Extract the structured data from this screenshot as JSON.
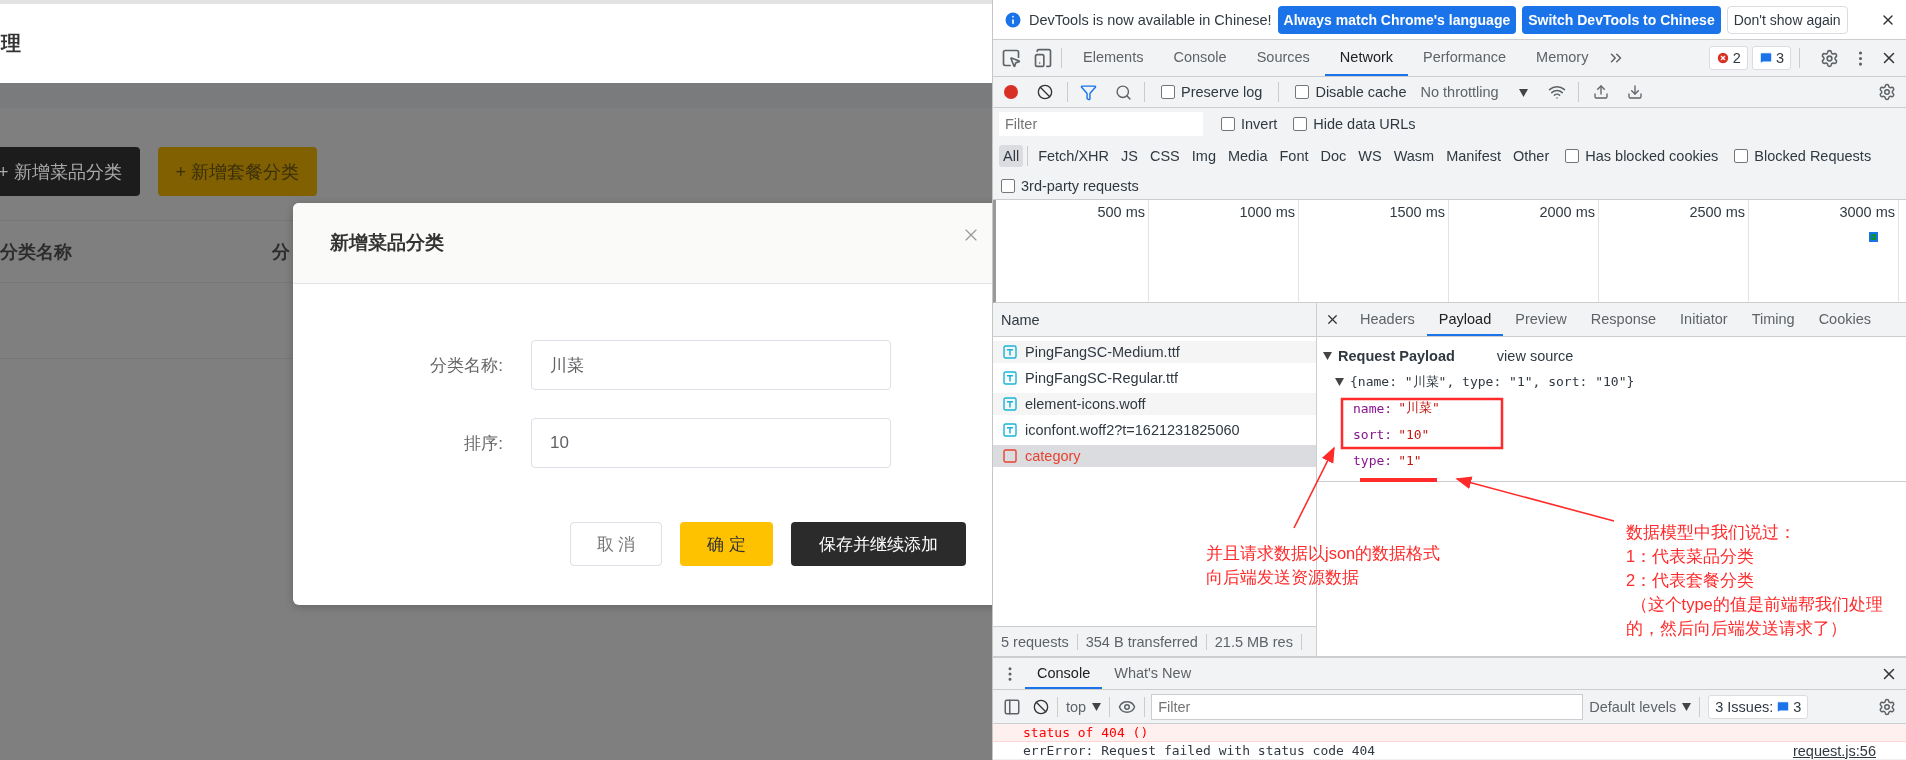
{
  "page": {
    "title": "理",
    "actions": [
      {
        "label": "+ 新增菜品分类",
        "kind": "dark"
      },
      {
        "label": "+ 新增套餐分类",
        "kind": "accent"
      }
    ],
    "columns": [
      "分类名称",
      "分"
    ]
  },
  "dialog": {
    "title": "新增菜品分类",
    "fields": [
      {
        "label": "分类名称:",
        "value": "川菜"
      },
      {
        "label": "排序:",
        "value": "10"
      }
    ],
    "buttons": [
      {
        "label": "取 消",
        "kind": "plain"
      },
      {
        "label": "确 定",
        "kind": "primary"
      },
      {
        "label": "保存并继续添加",
        "kind": "dark"
      }
    ]
  },
  "devtools": {
    "infobar": {
      "message": "DevTools is now available in Chinese!",
      "buttons": [
        {
          "label": "Always match Chrome's language",
          "kind": "primary"
        },
        {
          "label": "Switch DevTools to Chinese",
          "kind": "primary"
        },
        {
          "label": "Don't show again",
          "kind": "plain"
        }
      ]
    },
    "tabs": [
      {
        "label": "Elements",
        "selected": false
      },
      {
        "label": "Console",
        "selected": false
      },
      {
        "label": "Sources",
        "selected": false
      },
      {
        "label": "Network",
        "selected": true
      },
      {
        "label": "Performance",
        "selected": false
      },
      {
        "label": "Memory",
        "selected": false
      }
    ],
    "error_count": "2",
    "message_count": "3",
    "toolbar": {
      "checkboxes": [
        {
          "label": "Preserve log",
          "checked": false
        },
        {
          "label": "Disable cache",
          "checked": false
        }
      ],
      "throttling": "No throttling"
    },
    "filter": {
      "placeholder": "Filter",
      "checkboxes": [
        {
          "label": "Invert",
          "checked": false
        },
        {
          "label": "Hide data URLs",
          "checked": false
        }
      ]
    },
    "types": [
      {
        "label": "All",
        "selected": true
      },
      {
        "label": "Fetch/XHR",
        "selected": false
      },
      {
        "label": "JS",
        "selected": false
      },
      {
        "label": "CSS",
        "selected": false
      },
      {
        "label": "Img",
        "selected": false
      },
      {
        "label": "Media",
        "selected": false
      },
      {
        "label": "Font",
        "selected": false
      },
      {
        "label": "Doc",
        "selected": false
      },
      {
        "label": "WS",
        "selected": false
      },
      {
        "label": "Wasm",
        "selected": false
      },
      {
        "label": "Manifest",
        "selected": false
      },
      {
        "label": "Other",
        "selected": false
      }
    ],
    "type_checkboxes": [
      {
        "label": "Has blocked cookies",
        "checked": false
      },
      {
        "label": "Blocked Requests",
        "checked": false
      },
      {
        "label": "3rd-party requests",
        "checked": false
      }
    ],
    "timeline_ticks": [
      "500 ms",
      "1000 ms",
      "1500 ms",
      "2000 ms",
      "2500 ms",
      "3000 ms"
    ],
    "requests": {
      "header": "Name",
      "rows": [
        {
          "name": "PingFangSC-Medium.ttf",
          "kind": "font",
          "selected": false
        },
        {
          "name": "PingFangSC-Regular.ttf",
          "kind": "font",
          "selected": false
        },
        {
          "name": "element-icons.woff",
          "kind": "font",
          "selected": false
        },
        {
          "name": "iconfont.woff2?t=1621231825060",
          "kind": "font",
          "selected": false
        },
        {
          "name": "category",
          "kind": "failed",
          "selected": true
        }
      ],
      "summary": [
        "5 requests",
        "354 B transferred",
        "21.5 MB res"
      ]
    },
    "detail": {
      "tabs": [
        {
          "label": "Headers",
          "selected": false
        },
        {
          "label": "Payload",
          "selected": true
        },
        {
          "label": "Preview",
          "selected": false
        },
        {
          "label": "Response",
          "selected": false
        },
        {
          "label": "Initiator",
          "selected": false
        },
        {
          "label": "Timing",
          "selected": false
        },
        {
          "label": "Cookies",
          "selected": false
        }
      ],
      "section": "Request Payload",
      "view_source": "view source",
      "summary": "{name: \"川菜\", type: \"1\", sort: \"10\"}",
      "properties": [
        {
          "key": "name:",
          "value": "\"川菜\""
        },
        {
          "key": "sort:",
          "value": "\"10\""
        },
        {
          "key": "type:",
          "value": "\"1\""
        }
      ]
    },
    "drawer": {
      "tabs": [
        {
          "label": "Console",
          "selected": true
        },
        {
          "label": "What's New",
          "selected": false
        }
      ],
      "context": "top",
      "filter_placeholder": "Filter",
      "levels": "Default levels",
      "issues_label": "3 Issues:",
      "issues_count": "3",
      "messages": [
        {
          "text": "status of 404 ()",
          "kind": "error"
        },
        {
          "text": "errError: Request failed with status code 404",
          "kind": "log",
          "source": "request.js:56"
        }
      ]
    }
  },
  "annotations": {
    "notes": [
      {
        "lines": [
          "并且请求数据以json的数据格式",
          "向后端发送资源数据"
        ]
      },
      {
        "lines": [
          "数据模型中我们说过：",
          "1：代表菜品分类",
          "2：代表套餐分类",
          " （这个type的值是前端帮我们处理",
          "的，然后向后端发送请求了）"
        ]
      }
    ]
  }
}
